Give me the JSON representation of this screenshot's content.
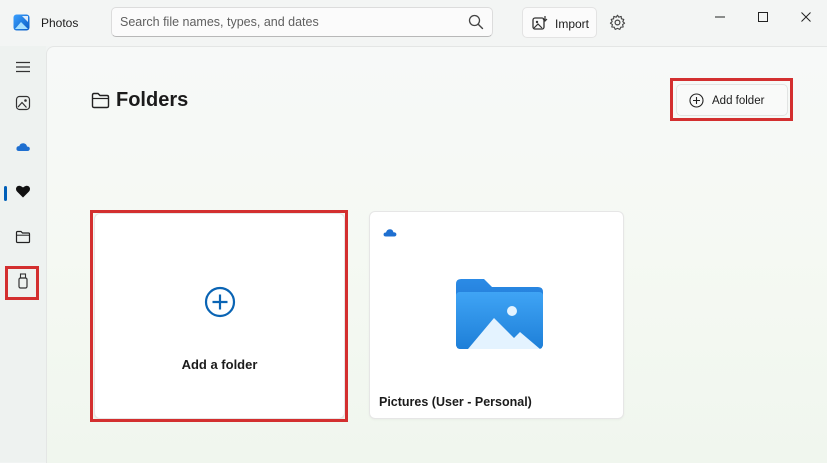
{
  "app": {
    "title": "Photos"
  },
  "search": {
    "placeholder": "Search file names, types, and dates",
    "value": ""
  },
  "toolbar": {
    "import_label": "Import"
  },
  "sidebar": {
    "items": [
      {
        "name": "menu",
        "icon": "hamburger-menu-icon"
      },
      {
        "name": "gallery",
        "icon": "gallery-icon"
      },
      {
        "name": "onedrive",
        "icon": "cloud-icon",
        "selected": true
      },
      {
        "name": "favorites",
        "icon": "heart-icon"
      },
      {
        "name": "folders",
        "icon": "folder-icon"
      },
      {
        "name": "external",
        "icon": "usb-drive-icon"
      }
    ]
  },
  "main": {
    "title": "Folders",
    "add_folder_label": "Add folder",
    "cards": [
      {
        "label": "Add a folder",
        "icon": "plus-circle-icon"
      },
      {
        "label": "Pictures (User - Personal)",
        "icon": "pictures-folder-icon",
        "badge_icon": "onedrive-cloud-icon"
      }
    ]
  },
  "colors": {
    "accent": "#005fb8",
    "highlight": "#d32f2f",
    "folder": "#1e88e5"
  }
}
